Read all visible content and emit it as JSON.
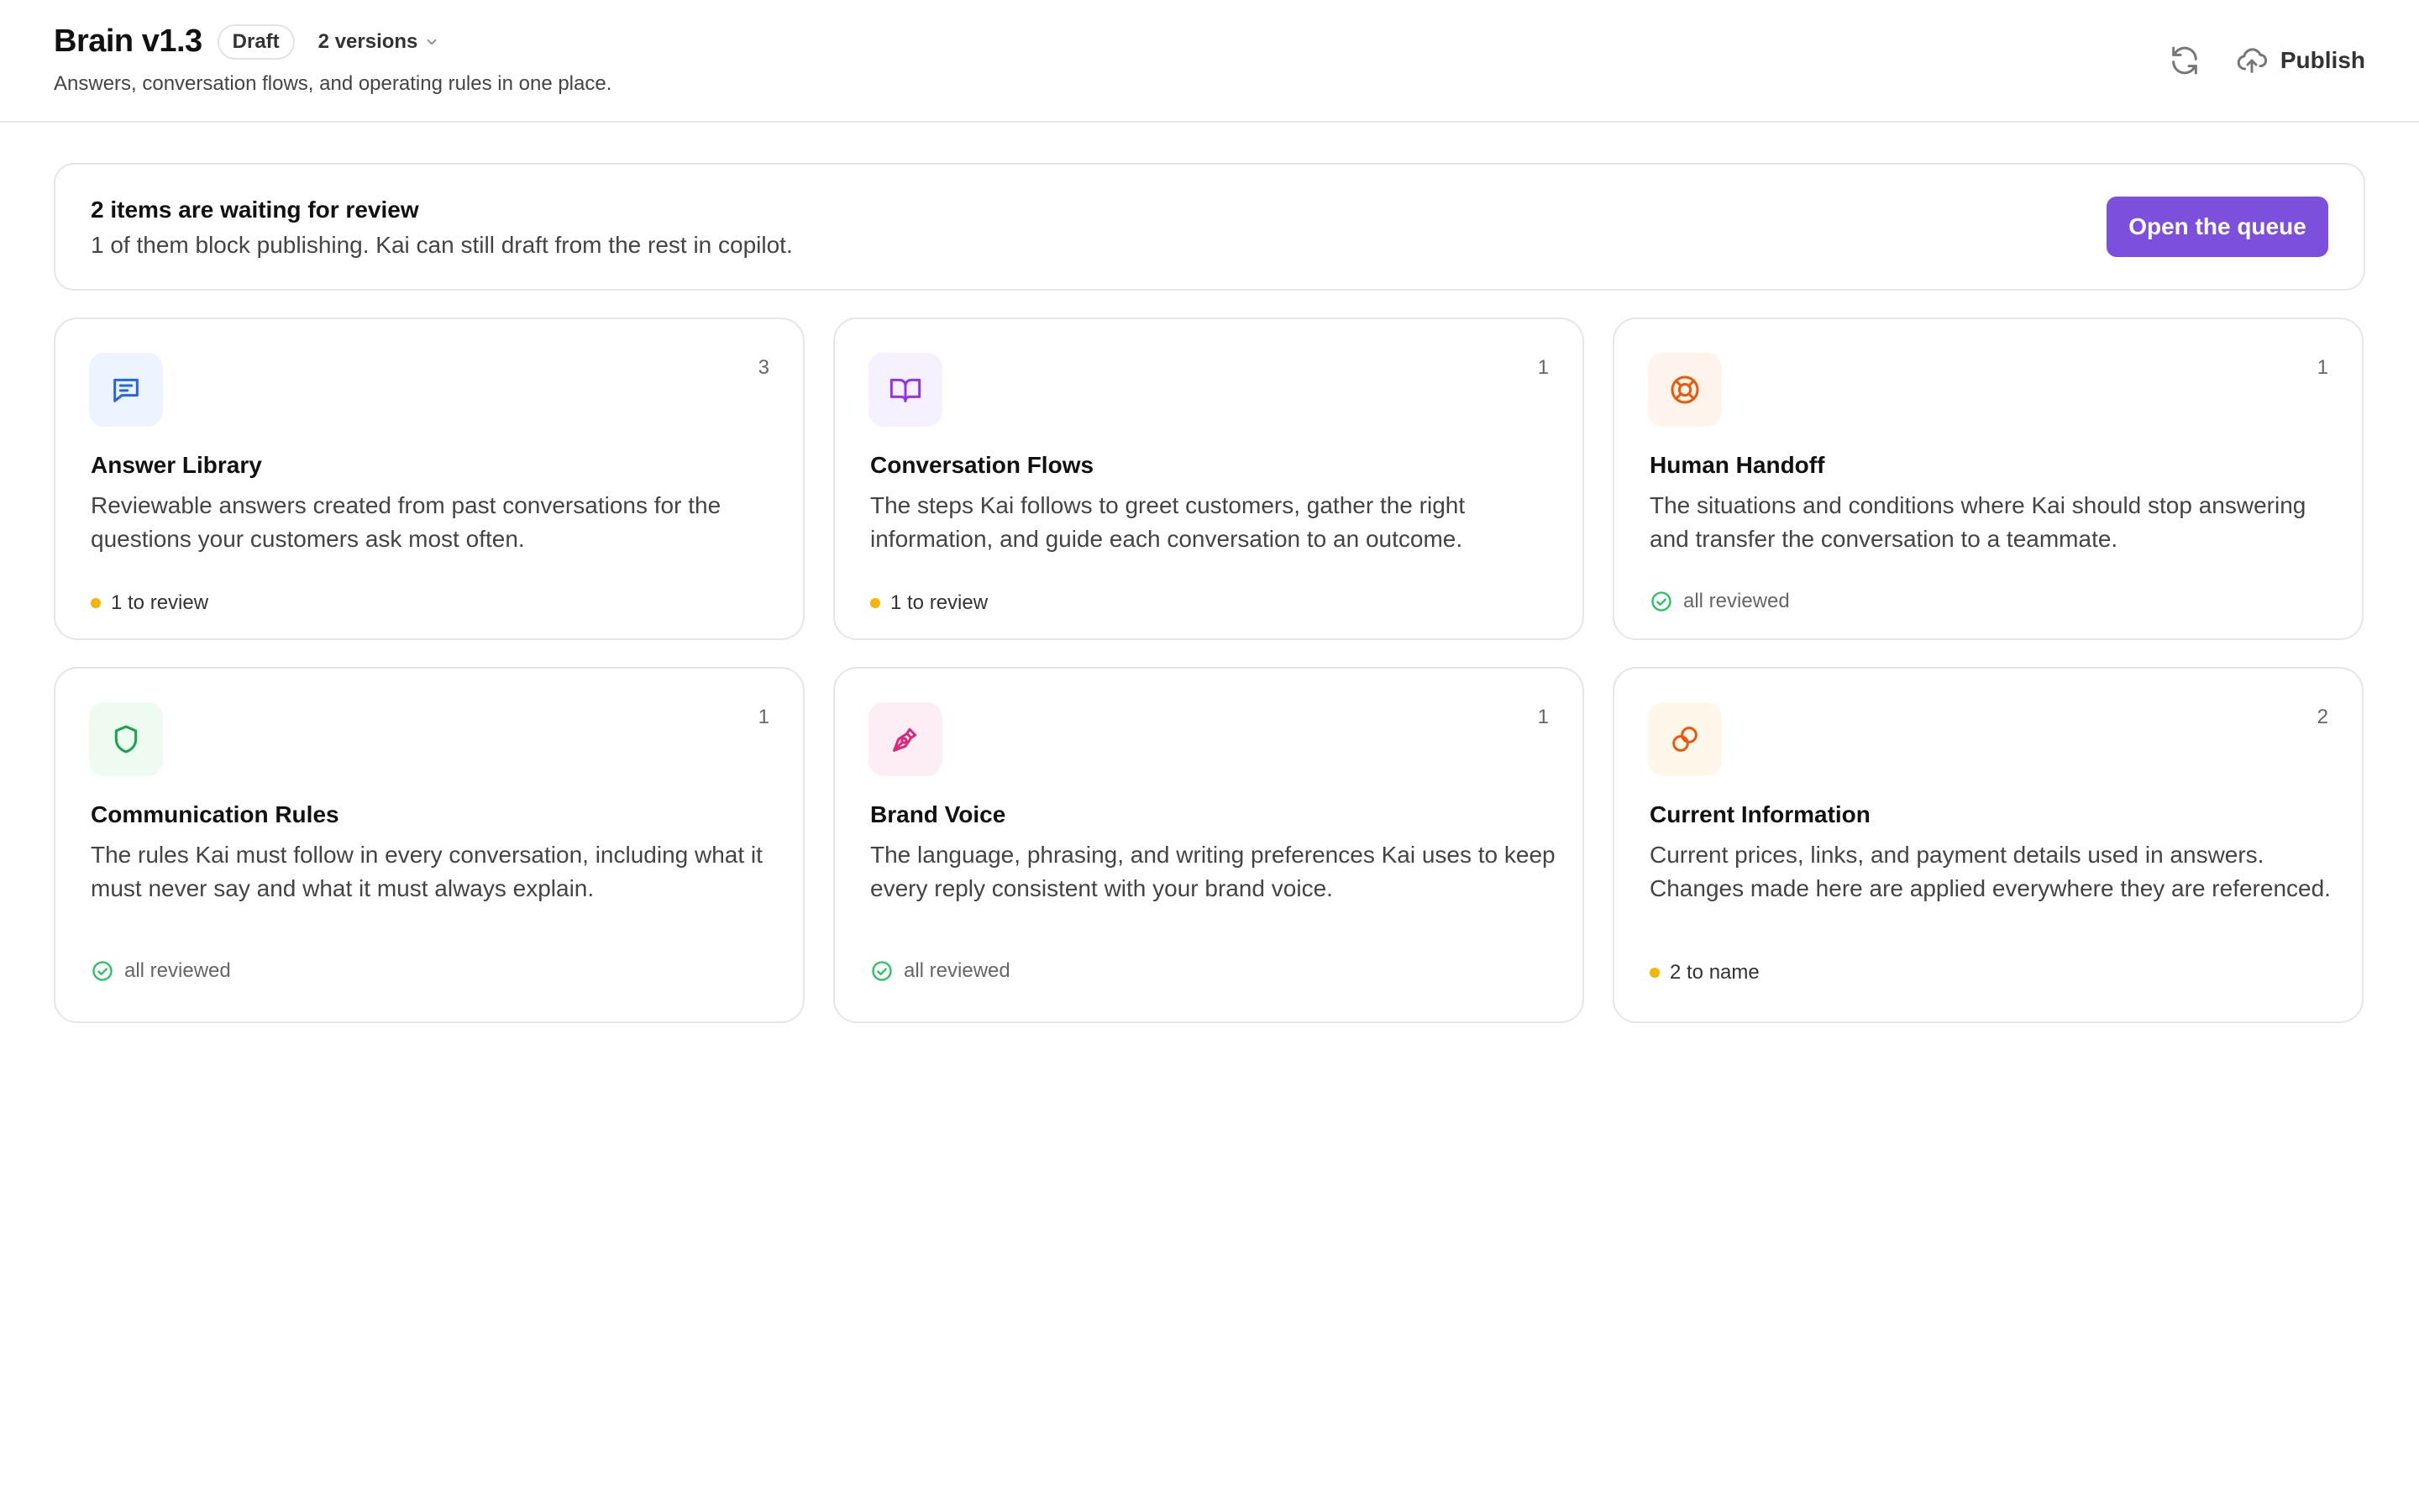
{
  "header": {
    "title": "Brain v1.3",
    "badge": "Draft",
    "versions": "2 versions",
    "subtitle": "Answers, conversation flows, and operating rules in one place.",
    "publish_label": "Publish"
  },
  "banner": {
    "title": "2 items are waiting for review",
    "subtitle": "1 of them block publishing. Kai can still draft from the rest in copilot.",
    "button": "Open the queue"
  },
  "cards": [
    {
      "icon": "chat-icon",
      "count": "3",
      "title": "Answer Library",
      "description": "Reviewable answers created from past conversations for the questions your customers ask most often.",
      "status": "1 to review",
      "status_type": "pending",
      "icon_color": "#2563eb",
      "icon_bg": "#eef4ff"
    },
    {
      "icon": "book-icon",
      "count": "1",
      "title": "Conversation Flows",
      "description": "The steps Kai follows to greet customers, gather the right information, and guide each conversation to an outcome.",
      "status": "1 to review",
      "status_type": "pending",
      "icon_color": "#9333ea",
      "icon_bg": "#f7f0fe"
    },
    {
      "icon": "lifebuoy-icon",
      "count": "1",
      "title": "Human Handoff",
      "description": "The situations and conditions where Kai should stop answering and transfer the conversation to a teammate.",
      "status": "all reviewed",
      "status_type": "done",
      "icon_color": "#ea580c",
      "icon_bg": "#fff4ec"
    },
    {
      "icon": "shield-icon",
      "count": "1",
      "title": "Communication Rules",
      "description": "The rules Kai must follow in every conversation, including what it must never say and what it must always explain.",
      "status": "all reviewed",
      "status_type": "done",
      "icon_color": "#16a34a",
      "icon_bg": "#edfbf1"
    },
    {
      "icon": "pen-icon",
      "count": "1",
      "title": "Brand Voice",
      "description": "The language, phrasing, and writing preferences Kai uses to keep every reply consistent with your brand voice.",
      "status": "all reviewed",
      "status_type": "done",
      "icon_color": "#db2777",
      "icon_bg": "#fdeef5"
    },
    {
      "icon": "rings-icon",
      "count": "2",
      "title": "Current Information",
      "description": "Current prices, links, and payment details used in answers. Changes made here are applied everywhere they are referenced.",
      "status": "2 to name",
      "status_type": "pending",
      "icon_color": "#ea580c",
      "icon_bg": "#fff8ea"
    }
  ],
  "colors": {
    "accent": "#7c4fdc",
    "pending_dot": "#f5b400",
    "done_check": "#22c55e"
  }
}
